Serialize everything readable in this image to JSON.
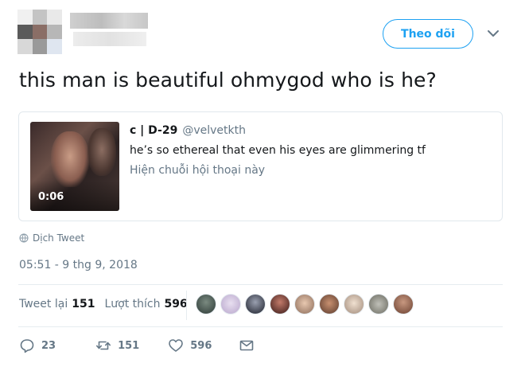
{
  "header": {
    "follow_label": "Theo dõi",
    "menu_icon": "chevron-down-icon"
  },
  "tweet": {
    "text": "this man is beautiful ohmygod who is he?",
    "translate_label": "Dịch Tweet",
    "timestamp": "05:51 - 9 thg 9, 2018"
  },
  "quote": {
    "name": "c | D-29",
    "handle": "@velvetkth",
    "text": "he’s so ethereal that even his eyes are glimmering tf",
    "show_thread": "Hiện chuỗi hội thoại này",
    "video_duration": "0:06"
  },
  "stats": {
    "retweets_label": "Tweet lại",
    "retweets": "151",
    "likes_label": "Lượt thích",
    "likes": "596"
  },
  "actions": {
    "replies": "23",
    "retweets": "151",
    "likes": "596"
  },
  "colors": {
    "accent": "#1da1f2",
    "muted": "#657786",
    "text": "#14171a",
    "border": "#e1e8ed"
  }
}
